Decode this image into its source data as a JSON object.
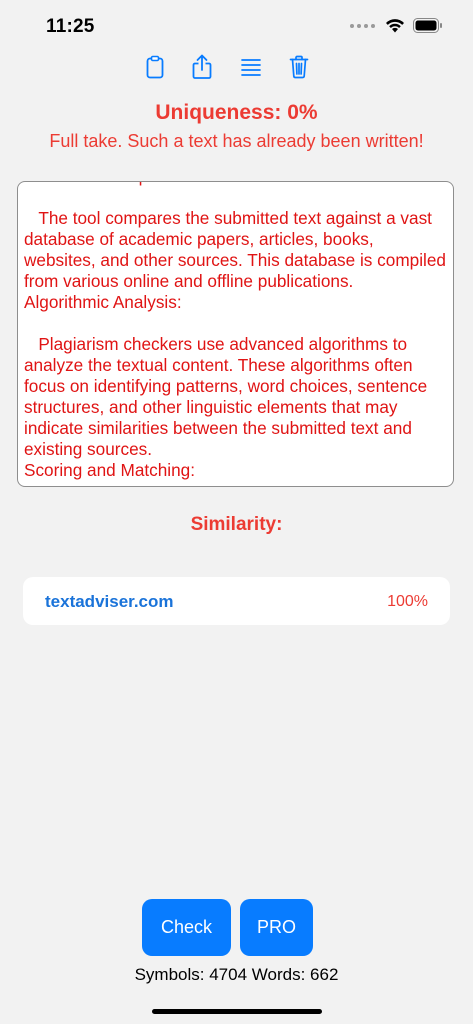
{
  "status_bar": {
    "time": "11:25"
  },
  "toolbar": {
    "icons": [
      "clipboard-icon",
      "share-icon",
      "list-icon",
      "trash-icon"
    ]
  },
  "result": {
    "title": "Uniqueness: 0%",
    "subtitle": "Full take. Such a text has already been written!"
  },
  "text_area": {
    "content": "Database Comparison:\n\n   The tool compares the submitted text against a vast database of academic papers, articles, books, websites, and other sources. This database is compiled from various online and offline publications.\nAlgorithmic Analysis:\n\n   Plagiarism checkers use advanced algorithms to analyze the textual content. These algorithms often focus on identifying patterns, word choices, sentence structures, and other linguistic elements that may indicate similarities between the submitted text and existing sources.\nScoring and Matching:"
  },
  "similarity": {
    "title": "Similarity:",
    "items": [
      {
        "site": "textadviser.com",
        "percent": "100%"
      }
    ]
  },
  "buttons": {
    "check": "Check",
    "pro": "PRO"
  },
  "counts": {
    "symbols": "Symbols: 4704",
    "words": "Words: 662"
  },
  "colors": {
    "accent_red": "#ec3b33",
    "link_blue": "#1a73d9",
    "button_blue": "#087cff"
  }
}
